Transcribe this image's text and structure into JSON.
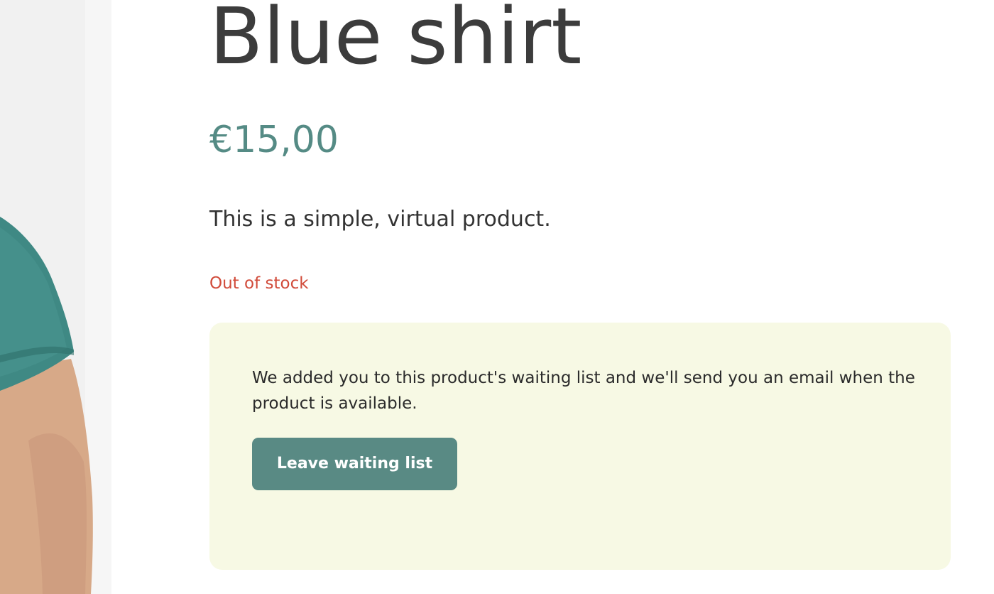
{
  "product": {
    "title": "Blue shirt",
    "price": "€15,00",
    "short_description": "This is a simple, virtual product.",
    "stock_status": "Out of stock"
  },
  "waitlist": {
    "message": "We added you to this product's waiting list and we'll send you an email when the product is available.",
    "leave_button_label": "Leave waiting list"
  },
  "colors": {
    "price": "#558b85",
    "stock_out": "#d14b3a",
    "waitlist_background": "#f7f9e4",
    "button_background": "#598a84",
    "shirt": "#3e8a85"
  }
}
